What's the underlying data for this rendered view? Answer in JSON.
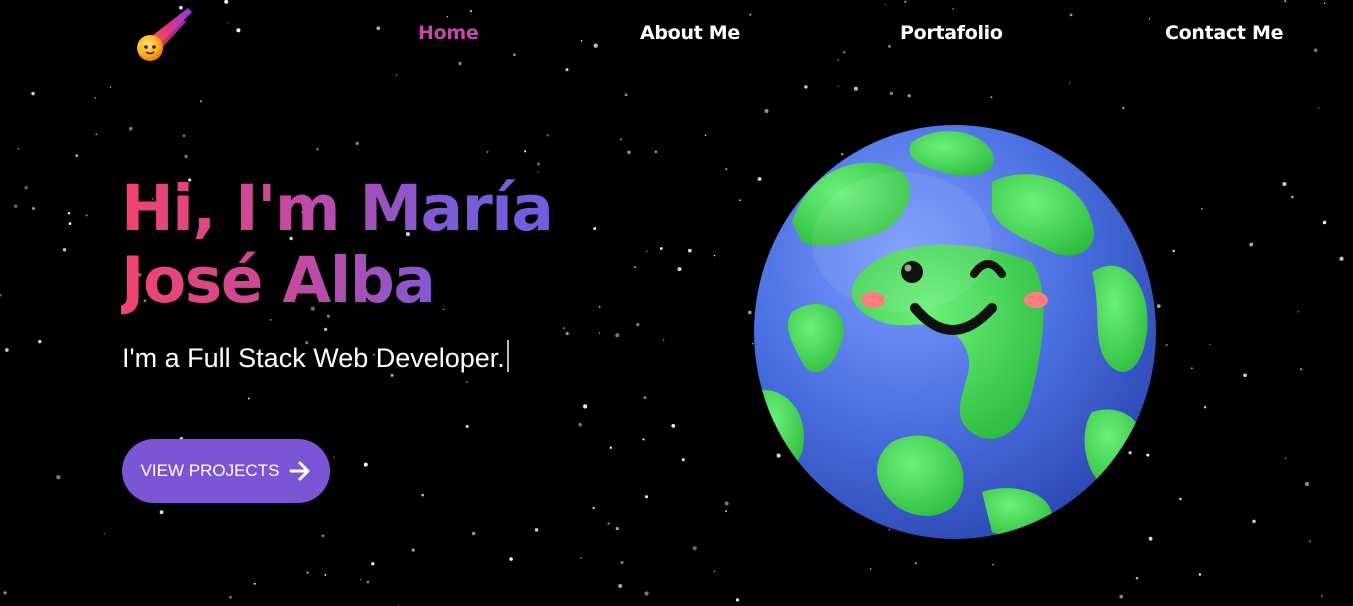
{
  "nav": {
    "items": [
      {
        "label": "Home",
        "active": true
      },
      {
        "label": "About Me",
        "active": false
      },
      {
        "label": "Portafolio",
        "active": false
      },
      {
        "label": "Contact Me",
        "active": false
      }
    ]
  },
  "hero": {
    "title_line1": "Hi, I'm María",
    "title_line2": "José Alba",
    "subtitle": "I'm a Full Stack Web Developer.",
    "cta_label": "VIEW PROJECTS"
  },
  "icons": {
    "logo": "comet-logo-icon",
    "cta_arrow": "arrow-right-icon",
    "illustration": "smiling-earth-illustration"
  },
  "colors": {
    "background": "#000000",
    "nav_active": "#c04aa6",
    "cta_background": "#7c55d6",
    "gradient_start": "#f0446c",
    "gradient_end": "#6a5fe0",
    "earth_ocean": "#4a6fe0",
    "earth_land": "#3fd64e"
  }
}
